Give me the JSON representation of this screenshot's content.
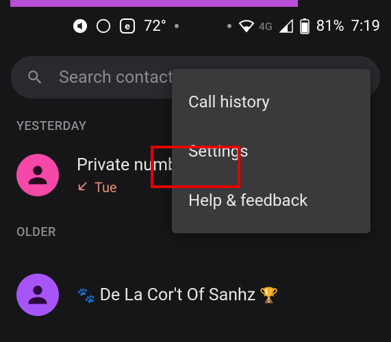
{
  "status": {
    "temperature": "72°",
    "network_type": "4G",
    "battery_percent": "81%",
    "time": "7:19"
  },
  "search": {
    "placeholder": "Search contacts"
  },
  "sections": {
    "yesterday": "YESTERDAY",
    "older": "OLDER"
  },
  "calls": {
    "item1": {
      "name": "Private number",
      "day": "Tue"
    },
    "item2": {
      "prefix": "🐾",
      "name": "De La Cor't Of Sanhz",
      "suffix": "🏆"
    }
  },
  "menu": {
    "call_history": "Call history",
    "settings": "Settings",
    "help": "Help & feedback"
  }
}
